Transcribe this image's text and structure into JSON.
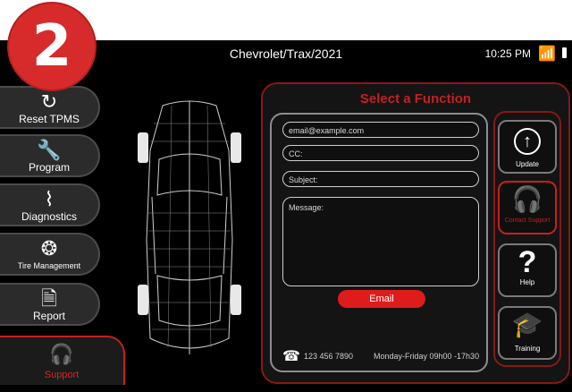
{
  "step_badge": "2",
  "header": {
    "title": "Chevrolet/Trax/2021",
    "time": "10:25 PM"
  },
  "sidebar": {
    "items": [
      {
        "label": "Reset TPMS",
        "icon": "tpms-reset-icon"
      },
      {
        "label": "Program",
        "icon": "sensor-program-icon"
      },
      {
        "label": "Diagnostics",
        "icon": "diagnostics-icon"
      },
      {
        "label": "Tire Management",
        "icon": "tire-icon"
      },
      {
        "label": "Report",
        "icon": "report-icon"
      }
    ],
    "support": {
      "label": "Support",
      "icon": "headset-icon"
    }
  },
  "panel": {
    "title": "Select a Function",
    "form": {
      "email_placeholder": "email@example.com",
      "cc_placeholder": "CC:",
      "subject_placeholder": "Subject:",
      "message_placeholder": "Message:",
      "submit_label": "Email"
    },
    "contact": {
      "phone": "123 456 7890",
      "hours": "Monday-Friday 09h00 -17h30"
    }
  },
  "actions": [
    {
      "label": "Update",
      "icon": "upload-arrow-icon"
    },
    {
      "label": "Contact Support",
      "icon": "headset-icon"
    },
    {
      "label": "Help",
      "icon": "question-mark-icon"
    },
    {
      "label": "Training",
      "icon": "graduation-cap-icon"
    }
  ],
  "colors": {
    "accent": "#d72b2b",
    "background": "#000000"
  }
}
